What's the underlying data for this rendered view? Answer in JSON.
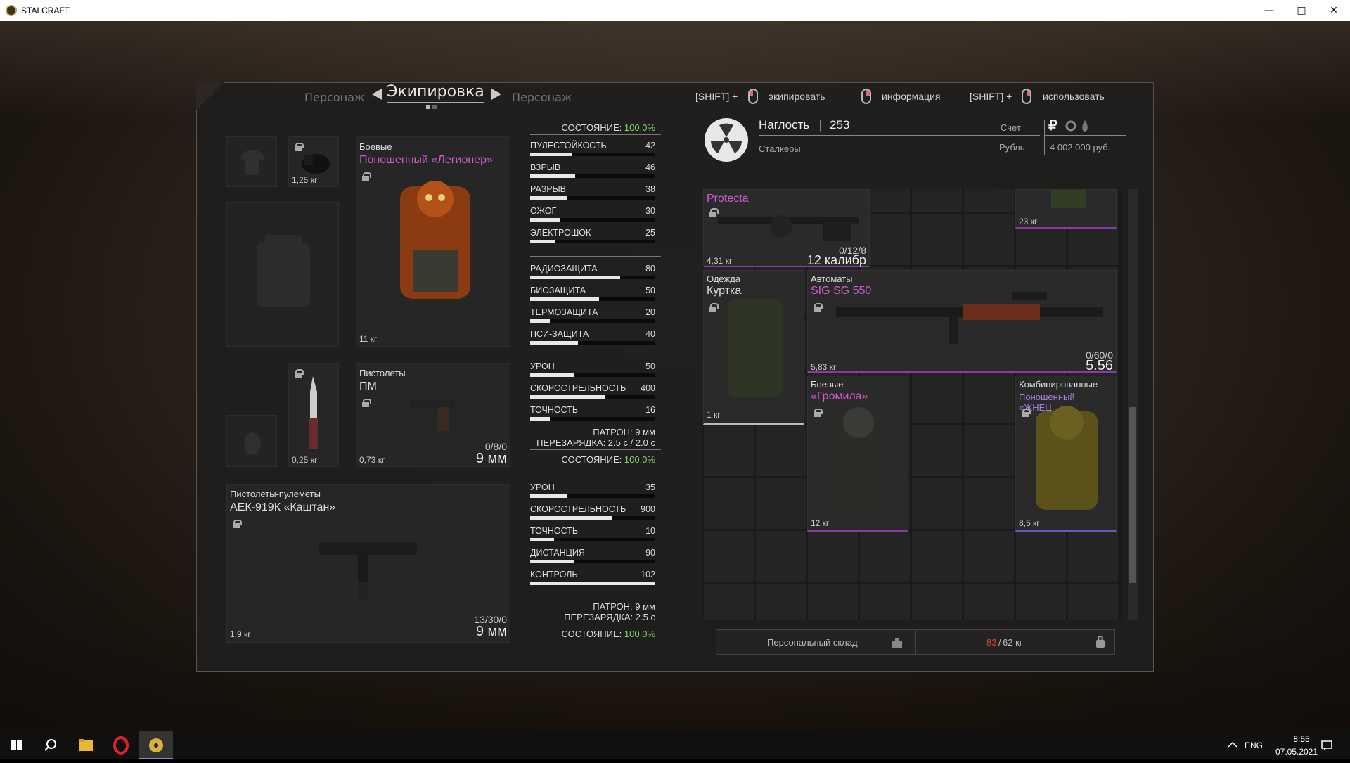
{
  "window": {
    "title": "STALCRAFT"
  },
  "header": {
    "tab_left": "Персонаж",
    "tab_active": "Экипировка",
    "tab_right": "Персонаж",
    "hint_equip_key": "[SHIFT] +",
    "hint_equip": "экипировать",
    "hint_info": "информация",
    "hint_use_key": "[SHIFT] +",
    "hint_use": "использовать"
  },
  "profile": {
    "name": "Наглость",
    "separator": "|",
    "level": "253",
    "faction": "Сталкеры",
    "account_label": "Счет",
    "currency_label": "Рубль",
    "currency_symbol": "₽",
    "balance": "4 002 000 руб."
  },
  "equipment": {
    "helmet_weight": "1,25 кг",
    "armor": {
      "category": "Боевые",
      "name": "Поношенный «Легионер»",
      "weight": "11 кг",
      "condition_label": "СОСТОЯНИЕ:",
      "condition_value": "100.0%",
      "stats": [
        {
          "name": "ПУЛЕСТОЙКОСТЬ",
          "value": "42",
          "fill": 0.33
        },
        {
          "name": "ВЗРЫВ",
          "value": "46",
          "fill": 0.36
        },
        {
          "name": "РАЗРЫВ",
          "value": "38",
          "fill": 0.3
        },
        {
          "name": "ОЖОГ",
          "value": "30",
          "fill": 0.24
        },
        {
          "name": "ЭЛЕКТРОШОК",
          "value": "25",
          "fill": 0.2
        }
      ],
      "prot": [
        {
          "name": "РАДИОЗАЩИТА",
          "value": "80",
          "fill": 0.72
        },
        {
          "name": "БИОЗАЩИТА",
          "value": "50",
          "fill": 0.55
        },
        {
          "name": "ТЕРМОЗАЩИТА",
          "value": "20",
          "fill": 0.16
        },
        {
          "name": "ПСИ-ЗАЩИТА",
          "value": "40",
          "fill": 0.38
        }
      ]
    },
    "knife_weight": "0,25 кг",
    "pistol": {
      "category": "Пистолеты",
      "name": "ПМ",
      "weight": "0,73 кг",
      "ammo": "0/8/0",
      "caliber": "9 мм",
      "stats": [
        {
          "name": "УРОН",
          "value": "50",
          "fill": 0.35
        },
        {
          "name": "СКОРОСТРЕЛЬНОСТЬ",
          "value": "400",
          "fill": 0.6
        },
        {
          "name": "ТОЧНОСТЬ",
          "value": "16",
          "fill": 0.16
        }
      ],
      "ammo_info": "ПАТРОН: 9 мм",
      "reload_info": "ПЕРЕЗАРЯДКА: 2.5 с / 2.0 с",
      "condition_label": "СОСТОЯНИЕ:",
      "condition_value": "100.0%"
    },
    "smg": {
      "category": "Пистолеты-пулеметы",
      "name": "АЕК-919К «Каштан»",
      "weight": "1,9 кг",
      "ammo": "13/30/0",
      "caliber": "9 мм",
      "stats": [
        {
          "name": "УРОН",
          "value": "35",
          "fill": 0.29
        },
        {
          "name": "СКОРОСТРЕЛЬНОСТЬ",
          "value": "900",
          "fill": 0.66
        },
        {
          "name": "ТОЧНОСТЬ",
          "value": "10",
          "fill": 0.19
        },
        {
          "name": "ДИСТАНЦИЯ",
          "value": "90",
          "fill": 0.35
        },
        {
          "name": "КОНТРОЛЬ",
          "value": "102",
          "fill": 1.0
        }
      ],
      "ammo_info": "ПАТРОН: 9 мм",
      "reload_info": "ПЕРЕЗАРЯДКА: 2.5 с",
      "condition_label": "СОСТОЯНИЕ:",
      "condition_value": "100.0%"
    }
  },
  "inventory": {
    "protecta": {
      "name": "Protecta",
      "weight": "4,31 кг",
      "ammo": "0/12/8",
      "caliber": "12 калибр"
    },
    "top_right_weight": "23 кг",
    "jacket": {
      "category": "Одежда",
      "name": "Куртка",
      "weight": "1 кг"
    },
    "sig": {
      "category": "Автоматы",
      "name": "SIG SG 550",
      "weight": "5,83 кг",
      "ammo": "0/60/0",
      "caliber": "5.56"
    },
    "gromila": {
      "category": "Боевые",
      "name": "«Громила»",
      "weight": "12 кг"
    },
    "combined": {
      "category": "Комбинированные",
      "name": "Поношенный «ЖНЕЦ...",
      "weight": "8,5 кг"
    }
  },
  "footer": {
    "storage": "Персональный склад",
    "weight_current": "83",
    "weight_sep": "/",
    "weight_max": "62 кг"
  },
  "taskbar": {
    "lang": "ENG",
    "time": "8:55",
    "date": "07.05.2021"
  },
  "colors": {
    "accent_pink": "#d25ad0",
    "condition_green": "#7ed36a",
    "overweight_red": "#e04040"
  }
}
